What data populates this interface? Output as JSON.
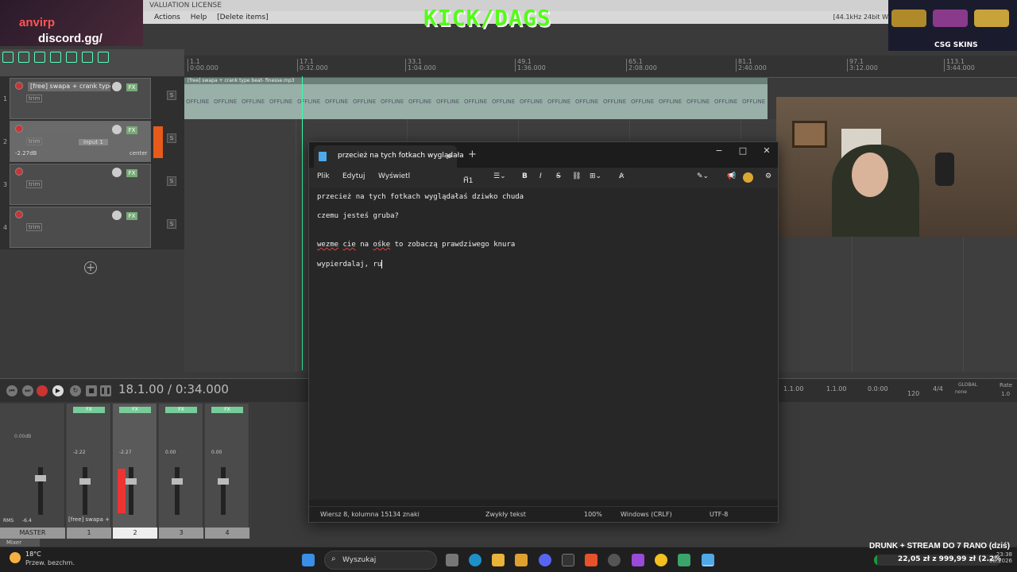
{
  "daw": {
    "window_title": "VALUATION LICENSE",
    "menu": [
      "Actions",
      "Help",
      "[Delete items]"
    ],
    "sample_rate": "[44.1kHz 24bit W",
    "ruler_marks": [
      {
        "bar": "1.1",
        "time": "0:00.000"
      },
      {
        "bar": "17.1",
        "time": "0:32.000"
      },
      {
        "bar": "33.1",
        "time": "1:04.000"
      },
      {
        "bar": "49.1",
        "time": "1:36.000"
      },
      {
        "bar": "65.1",
        "time": "2:08.000"
      },
      {
        "bar": "81.1",
        "time": "2:40.000"
      },
      {
        "bar": "97.1",
        "time": "3:12.000"
      },
      {
        "bar": "113.1",
        "time": "3:44.000"
      }
    ],
    "item_name": "[free] swapa + crank type beat- finesse.mp3",
    "offline_label": "OFFLINE",
    "tracks": [
      {
        "num": "1",
        "name": "[free] swapa + crank type",
        "trim": "trim"
      },
      {
        "num": "2",
        "name": "",
        "trim": "trim",
        "input": "Input 1",
        "volume": "-2.27dB",
        "pan": "center"
      },
      {
        "num": "3",
        "name": "",
        "trim": "trim"
      },
      {
        "num": "4",
        "name": "",
        "trim": "trim"
      }
    ],
    "fx_label": "FX",
    "timecode": "18.1.00 / 0:34.000",
    "right_values": [
      "1.1.00",
      "1.1.00",
      "0.0:00"
    ],
    "bpm": "120",
    "time_sig": "4/4",
    "rate": "1.0",
    "rate_label": "Rate",
    "global_label": "GLOBAL",
    "none_label": "none",
    "mixer": {
      "master_label": "MASTER",
      "master_db": "0.00dB",
      "rms": "RMS",
      "rms_val": "-6.4",
      "strips": [
        {
          "num": "1",
          "label": "[free] swapa +",
          "val": "-2.22"
        },
        {
          "num": "2",
          "label": "",
          "val": "-2.27"
        },
        {
          "num": "3",
          "label": "",
          "val": "0.00"
        },
        {
          "num": "4",
          "label": "",
          "val": "0.00"
        }
      ],
      "mixer_tab": "Mixer"
    }
  },
  "overlay": {
    "discord_prefix": "discord.gg/",
    "discord_suffix": "anvirp",
    "kick_text": "KICK/DAGS",
    "csg_label": "CSG SKINS"
  },
  "notepad": {
    "tab_title": "przecież na tych fotkach wyglądała",
    "menu": [
      "Plik",
      "Edytuj",
      "Wyświetl"
    ],
    "heading_btn": "H1",
    "lines": [
      {
        "text": "przecież na tych fotkach wyglądałaś dziwko chuda"
      },
      {
        "text": "czemu jesteś gruba?"
      },
      {
        "text": ""
      },
      {
        "pre": "",
        "sq1": "wezme",
        "mid1": " ",
        "sq2": "cie",
        "mid2": " na ",
        "sq3": "ośke",
        "post": " to zobaczą prawdziwego knura"
      },
      {
        "text": "wypierdalaj, ru"
      }
    ],
    "status": {
      "position": "Wiersz 8, kolumna 15",
      "chars": "134 znaki",
      "mode": "Zwykły tekst",
      "zoom": "100%",
      "eol": "Windows (CRLF)",
      "encoding": "UTF-8"
    }
  },
  "taskbar": {
    "temp": "18°C",
    "weather": "Przew. bezchm.",
    "search_placeholder": "Wyszukaj",
    "stream_title": "DRUNK + STREAM DO 7 RANO (dziś)",
    "goal_text": "22,05 zł z 999,99 zł (2.2%)",
    "goal_fraction": 0.022,
    "time": "23:38",
    "date": "08.2026"
  }
}
